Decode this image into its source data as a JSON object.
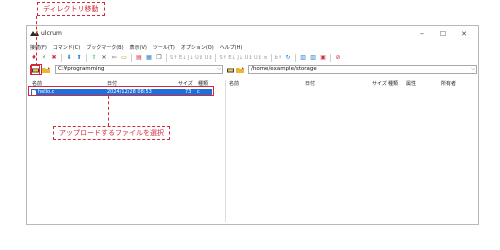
{
  "callouts": {
    "top": "ディレクトリ移動",
    "middle": "アップロードするファイルを選択"
  },
  "window": {
    "title": "ulcrum",
    "minimize": "–",
    "maximize": "☐",
    "close": "✕"
  },
  "menu": [
    {
      "label": "接続(F)"
    },
    {
      "label": "コマンド(C)"
    },
    {
      "label": "ブックマーク(B)"
    },
    {
      "label": "表示(V)"
    },
    {
      "label": "ツール(T)"
    },
    {
      "label": "オプション(O)"
    },
    {
      "label": "ヘルプ(H)"
    }
  ],
  "toolbar": {
    "text1": "S↑ E↓ J↓ U↕ U↕",
    "text2": "S↑ E↓ J↓ U↕ U↕ ≡",
    "text3": "b↑"
  },
  "left": {
    "path": "C:¥programming",
    "columns": {
      "name": "名前",
      "date": "日付",
      "size": "サイズ",
      "type": "種類"
    },
    "files": [
      {
        "name": "hello.c",
        "date": "2024/12/28 08:53",
        "size": "73",
        "type": "c"
      }
    ]
  },
  "right": {
    "path": "/home/example/storage",
    "columns": {
      "name": "名前",
      "date": "日付",
      "size": "サイズ",
      "type": "種類",
      "attr": "属性",
      "owner": "所有者"
    }
  },
  "colors": {
    "accent_red": "#d22a3a",
    "selection_blue": "#1e6fd9"
  }
}
